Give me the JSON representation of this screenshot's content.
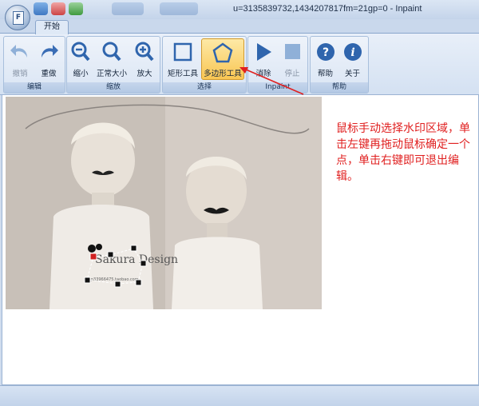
{
  "window": {
    "title": "u=3135839732,1434207817fm=21gp=0     - Inpaint"
  },
  "tabs": [
    {
      "label": "开始"
    }
  ],
  "ribbon": {
    "groups": [
      {
        "label": "编辑",
        "buttons": [
          {
            "label": "撤销",
            "icon": "undo-icon"
          },
          {
            "label": "重做",
            "icon": "redo-icon"
          }
        ]
      },
      {
        "label": "缩放",
        "buttons": [
          {
            "label": "缩小",
            "icon": "zoom-out-icon"
          },
          {
            "label": "正常大小",
            "icon": "zoom-normal-icon"
          },
          {
            "label": "放大",
            "icon": "zoom-in-icon"
          }
        ]
      },
      {
        "label": "选择",
        "buttons": [
          {
            "label": "矩形工具",
            "icon": "rectangle-icon"
          },
          {
            "label": "多边形工具",
            "icon": "polygon-icon"
          }
        ]
      },
      {
        "label": "Inpaint",
        "buttons": [
          {
            "label": "消除",
            "icon": "play-icon"
          },
          {
            "label": "停止",
            "icon": "stop-icon"
          }
        ]
      },
      {
        "label": "帮助",
        "buttons": [
          {
            "label": "帮助",
            "icon": "help-icon"
          },
          {
            "label": "关于",
            "icon": "info-icon"
          }
        ]
      }
    ]
  },
  "canvas": {
    "watermark_text": "Sakura Design",
    "watermark_subtext": "shop33966475.taobao.com"
  },
  "instruction": "鼠标手动选择水印区域，单击左键再拖动鼠标确定一个点，单击右键即可退出编辑。",
  "colors": {
    "accent": "#3a6db5",
    "annotation": "#e02020",
    "active_button": "#f9c653"
  }
}
